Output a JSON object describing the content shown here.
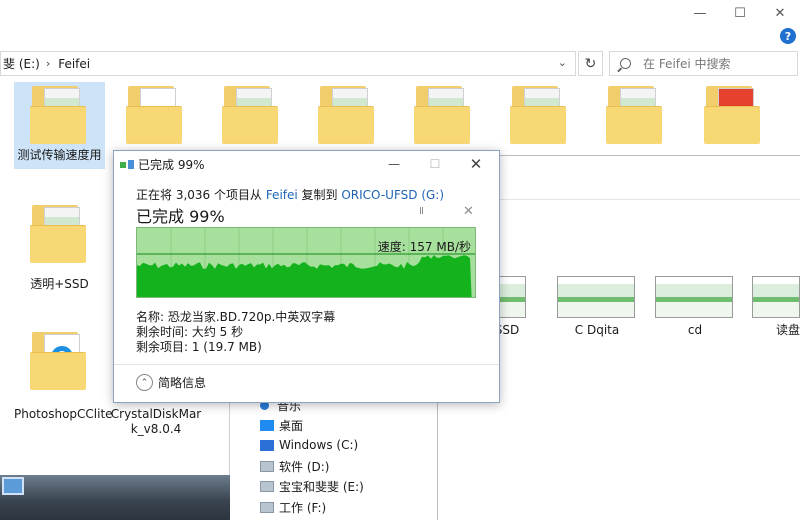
{
  "window": {
    "minimize": "—",
    "maximize": "☐",
    "close": "✕",
    "help": "?"
  },
  "address": {
    "crumb_partial": "斐 (E:)",
    "crumb_current": "Feifei",
    "separator": "›",
    "dropdown": "⌄",
    "refresh": "↻"
  },
  "search": {
    "placeholder": "在 Feifei 中搜索"
  },
  "folders_top": [
    {
      "label": "测试传输速度用"
    }
  ],
  "folders_left": [
    {
      "label": "透明+SSD"
    },
    {
      "label": "PhotoshopCClite"
    },
    {
      "label": "CrystalDiskMar k_v8.0.4"
    }
  ],
  "thumbs": [
    {
      "label": "SSD"
    },
    {
      "label": "C Dqita"
    },
    {
      "label": "cd"
    },
    {
      "label": "读盘"
    }
  ],
  "nav_pane": [
    {
      "label": "音乐",
      "icon": "music-icon"
    },
    {
      "label": "桌面",
      "icon": "desktop-icon"
    },
    {
      "label": "Windows (C:)",
      "icon": "windows-drive-icon"
    },
    {
      "label": "软件 (D:)",
      "icon": "drive-icon"
    },
    {
      "label": "宝宝和斐斐 (E:)",
      "icon": "drive-icon"
    },
    {
      "label": "工作 (F:)",
      "icon": "drive-icon"
    }
  ],
  "dialog": {
    "title": "已完成 99%",
    "desc_prefix": "正在将 3,036 个项目从 ",
    "source": "Feifei",
    "desc_mid": " 复制到 ",
    "destination": "ORICO-UFSD (G:)",
    "big_status": "已完成 99%",
    "pause": "II",
    "cancel": "✕",
    "speed": "速度: 157 MB/秒",
    "progress": 0.99,
    "name_line": "名称: 恐龙当家.BD.720p.中英双字幕",
    "time_line": "剩余时间: 大约 5 秒",
    "items_line": "剩余项目: 1 (19.7 MB)",
    "details_label": "简略信息",
    "details_chevron": "⌃"
  },
  "colors": {
    "graph_bg": "#a6e09c",
    "graph_fill": "#14b21c",
    "link": "#1e64b8",
    "selection": "#cde3f7"
  }
}
